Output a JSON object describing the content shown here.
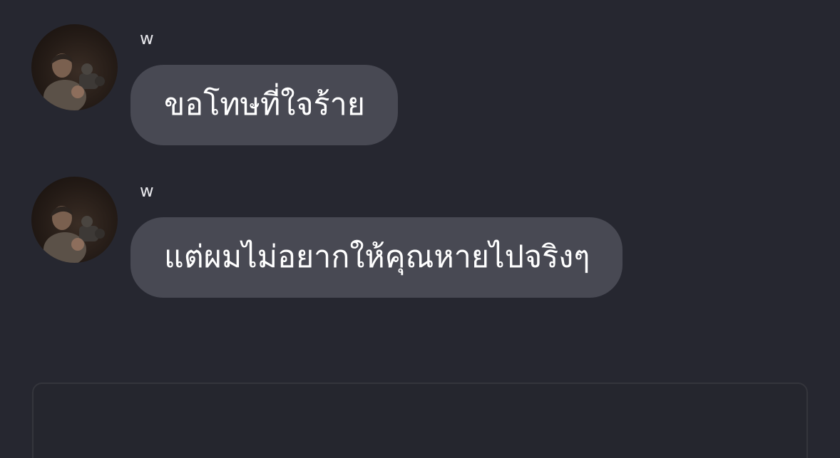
{
  "conversation": {
    "messages": [
      {
        "sender": "w",
        "text": "ขอโทษที่ใจร้าย",
        "avatar_icon": "profile-photo"
      },
      {
        "sender": "w",
        "text": "แต่ผมไม่อยากให้คุณหายไปจริงๆ",
        "avatar_icon": "profile-photo"
      }
    ]
  },
  "composer": {
    "value": ""
  },
  "colors": {
    "background": "#262730",
    "bubble": "#484953",
    "text": "#ffffff",
    "sender_text": "#e6e6ea",
    "composer_border": "#34353c"
  }
}
